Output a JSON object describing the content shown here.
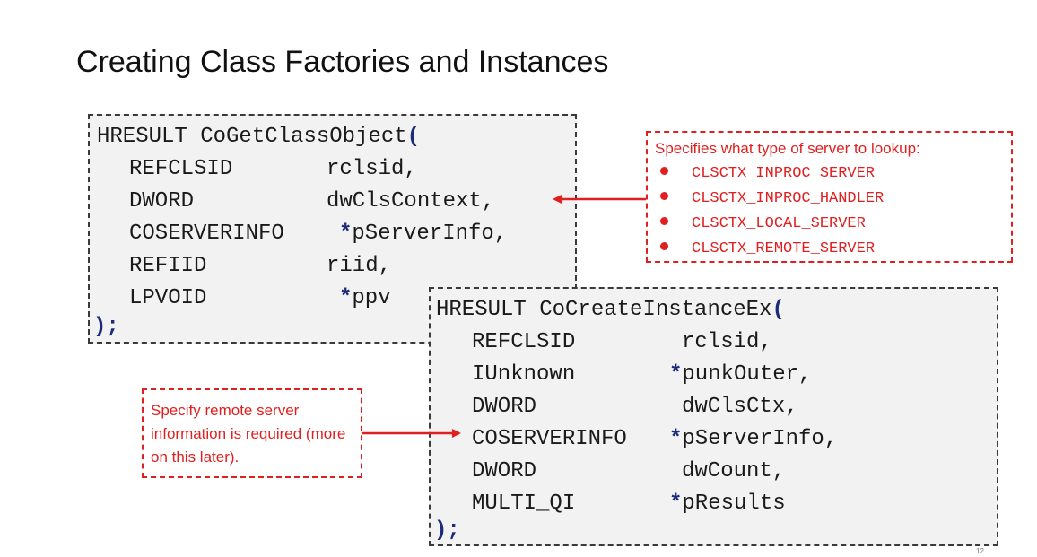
{
  "slide": {
    "title": "Creating Class Factories and Instances",
    "number": "12"
  },
  "code1": {
    "signature": "HRESULT CoGetClassObject",
    "open": "(",
    "close": ");",
    "params": [
      {
        "type": "REFCLSID",
        "star": "",
        "name": "rclsid,"
      },
      {
        "type": "DWORD",
        "star": "",
        "name": "dwClsContext,"
      },
      {
        "type": "COSERVERINFO",
        "star": "*",
        "name": "pServerInfo,"
      },
      {
        "type": "REFIID",
        "star": "",
        "name": "riid,"
      },
      {
        "type": "LPVOID",
        "star": "*",
        "name": "ppv"
      }
    ]
  },
  "code2": {
    "signature": "HRESULT CoCreateInstanceEx",
    "open": "(",
    "close": ");",
    "params": [
      {
        "type": "REFCLSID",
        "star": "",
        "name": "rclsid,"
      },
      {
        "type": "IUnknown",
        "star": "*",
        "name": "punkOuter,"
      },
      {
        "type": "DWORD",
        "star": "",
        "name": "dwClsCtx,"
      },
      {
        "type": "COSERVERINFO",
        "star": "*",
        "name": "pServerInfo,"
      },
      {
        "type": "DWORD",
        "star": "",
        "name": "dwCount,"
      },
      {
        "type": "MULTI_QI",
        "star": "*",
        "name": "pResults"
      }
    ]
  },
  "callout_server_type": {
    "heading": "Specifies what type of server to lookup:",
    "items": [
      "CLSCTX_INPROC_SERVER",
      "CLSCTX_INPROC_HANDLER",
      "CLSCTX_LOCAL_SERVER",
      "CLSCTX_REMOTE_SERVER"
    ]
  },
  "callout_remote": {
    "text": "Specify remote server information is required (more on this later)."
  },
  "colors": {
    "accent_red": "#e02020",
    "keyword_blue": "#1b2a7a",
    "code_bg": "#f2f2f2"
  }
}
